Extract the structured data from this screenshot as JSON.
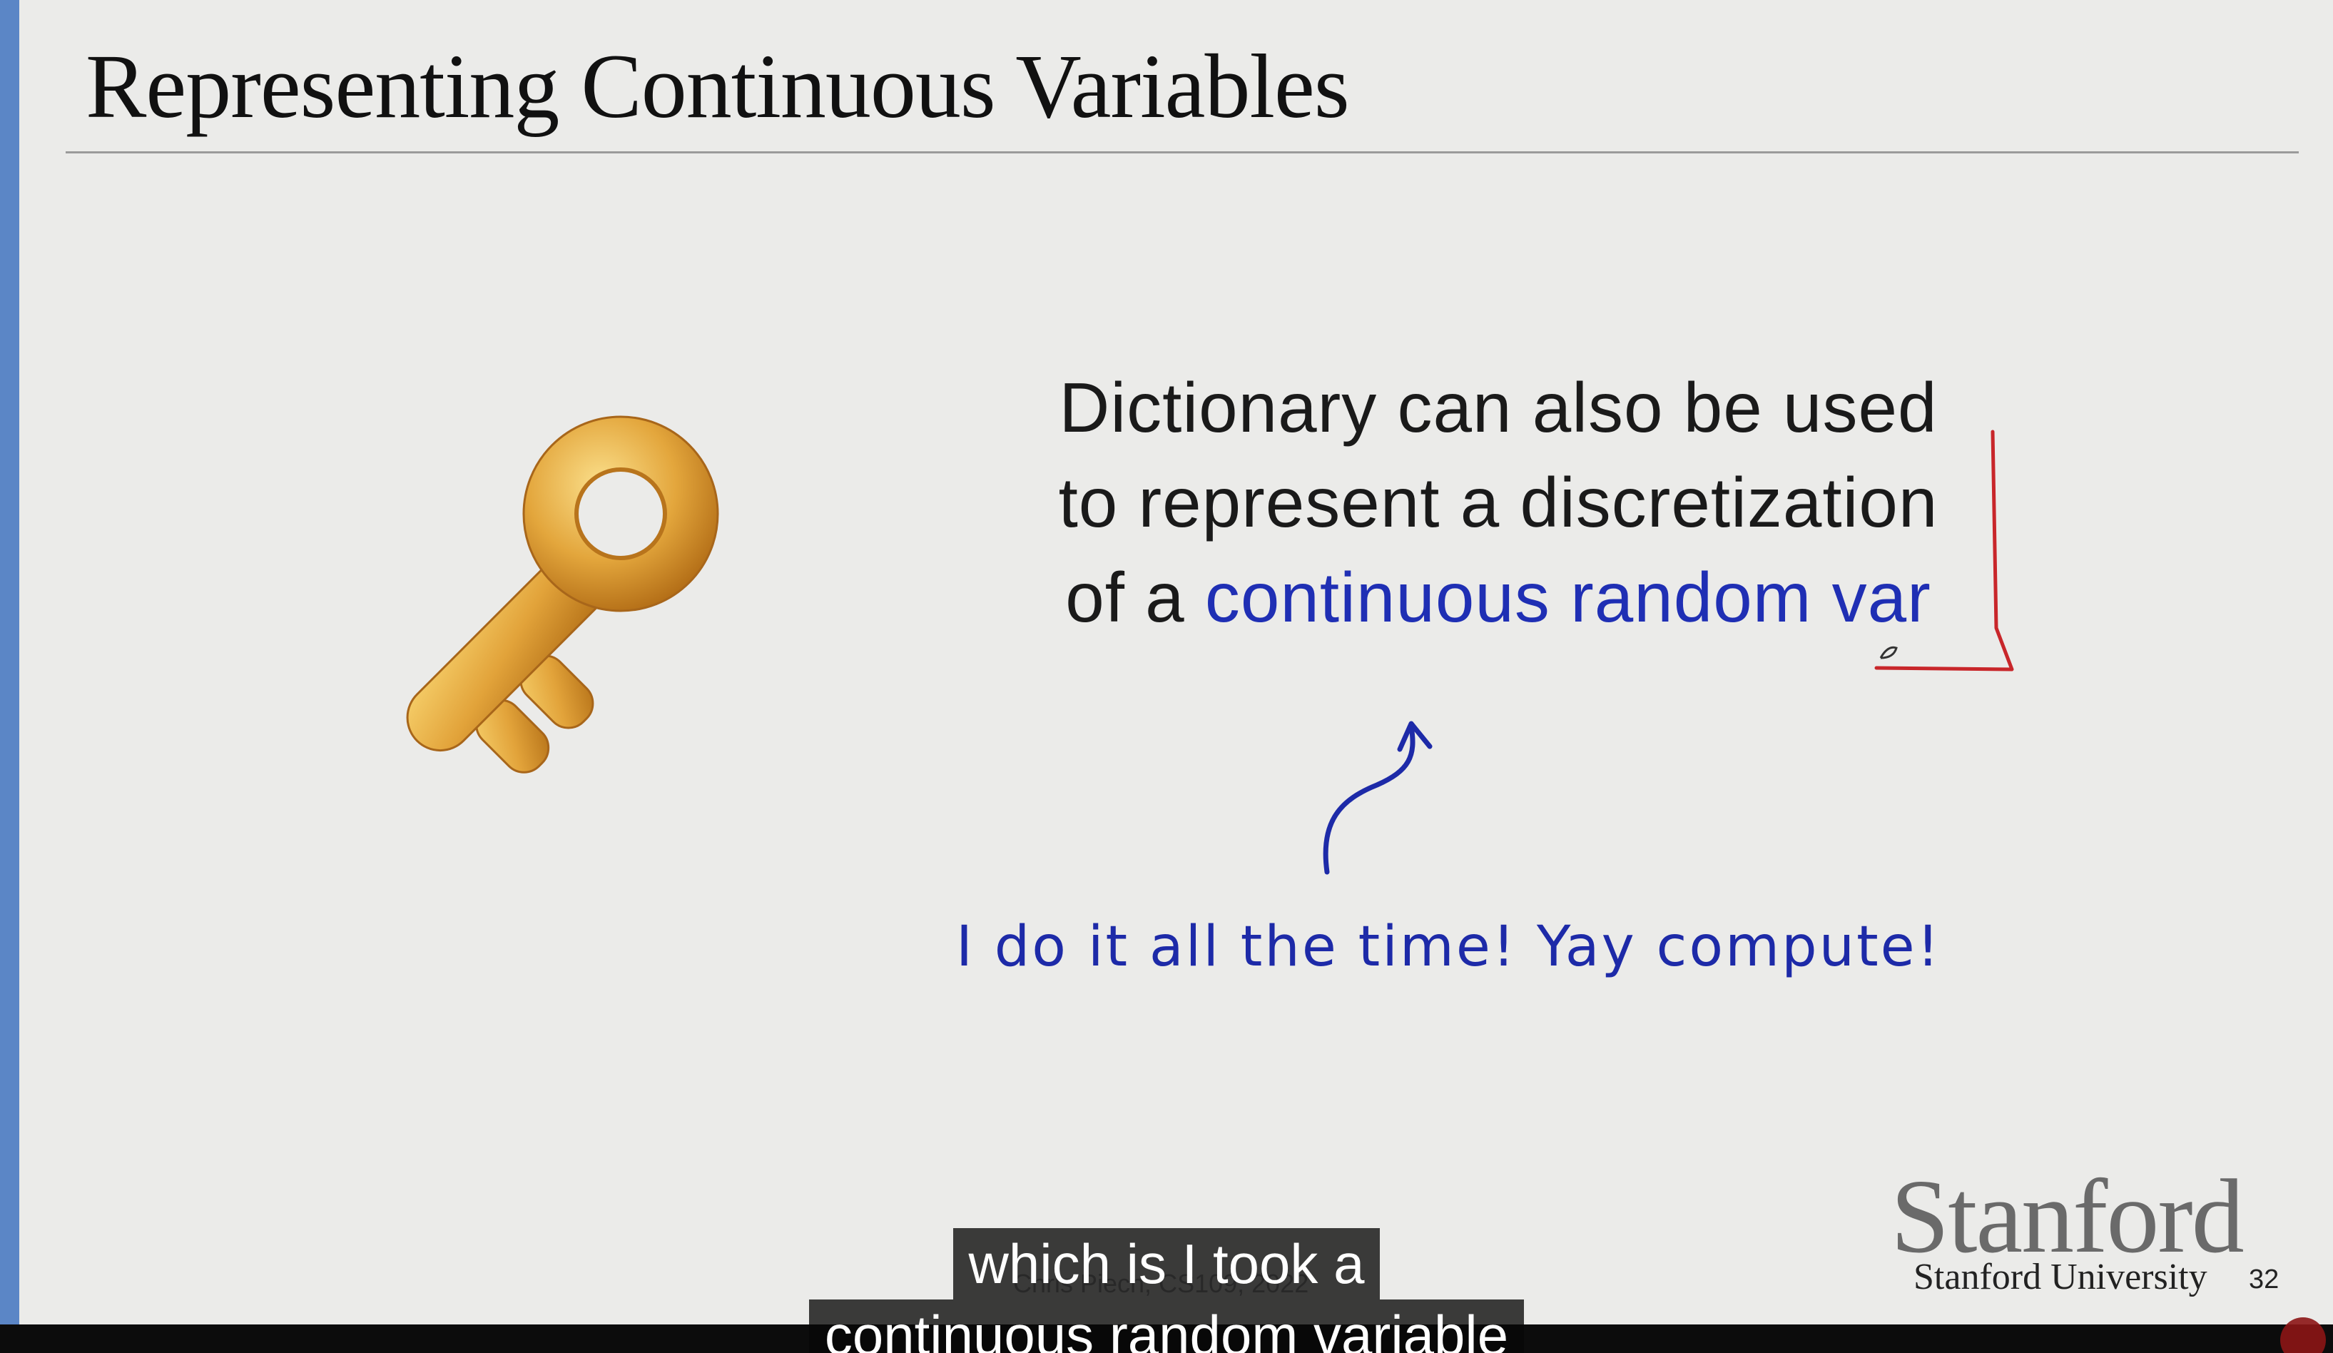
{
  "slide": {
    "title": "Representing Continuous Variables",
    "body_line1": "Dictionary can also be used",
    "body_line2": "to represent a discretization",
    "body_line3_prefix": "of a ",
    "body_line3_highlight": "continuous random var",
    "handwritten_note": "I do it all the time! Yay compute!",
    "key_icon": "key-icon",
    "footer_faint": "Chris Piech, CS109, 2022",
    "logo": "Stanford",
    "institution": "Stanford University",
    "page_number": "32"
  },
  "captions": {
    "line1": "which is I took a",
    "line2": "continuous random variable"
  },
  "colors": {
    "accent_bar": "#5b86c6",
    "highlight_text": "#1f2fb4",
    "annotation_red": "#c8262a",
    "annotation_blue": "#1d2aa8",
    "key_gold": "#d99a2b"
  }
}
